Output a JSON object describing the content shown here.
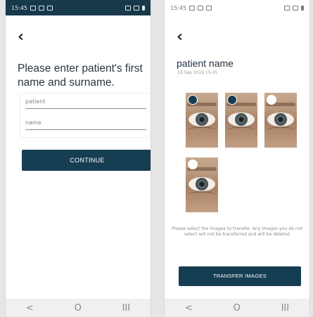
{
  "left_screen": {
    "status_time": "15:45",
    "heading": "Please enter patient's first name and surname.",
    "first_name_placeholder": "patient",
    "surname_placeholder": "name",
    "continue_label": "CONTINUE",
    "nav": {
      "back": "<",
      "home": "O",
      "recents": "III"
    }
  },
  "right_screen": {
    "status_time": "15:45",
    "patient_name": "patient name",
    "timestamp": "19 Sep 2019 15:45",
    "images": [
      {
        "selected": true
      },
      {
        "selected": true
      },
      {
        "selected": false
      },
      {
        "selected": false
      }
    ],
    "info_text": "Please select the images to transfer. Any images you do not select will not be transferred and will be deleted",
    "transfer_label": "TRANSFER IMAGES",
    "nav": {
      "back": "<",
      "home": "O",
      "recents": "III"
    }
  },
  "colors": {
    "primary": "#163e52",
    "status_bar_dark": "#17394a"
  }
}
